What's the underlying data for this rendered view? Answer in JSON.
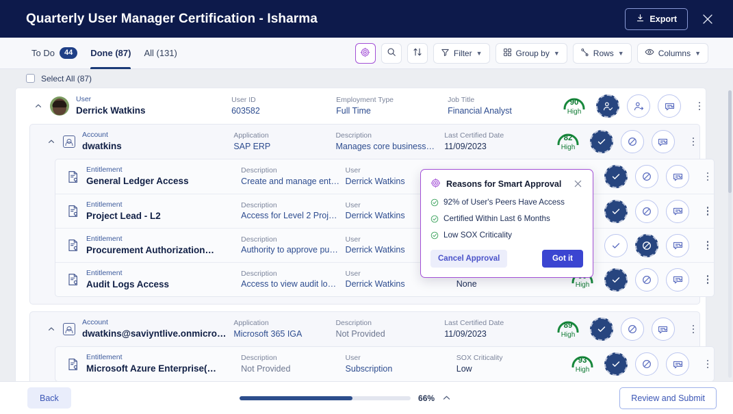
{
  "header": {
    "title": "Quarterly User Manager Certification - Isharma",
    "export_label": "Export",
    "export_icon": "download-icon",
    "close_icon": "close-icon"
  },
  "toolbar": {
    "tabs": [
      {
        "label": "To Do",
        "badge": "44",
        "active": false
      },
      {
        "label": "Done (87)",
        "badge": "",
        "active": true
      },
      {
        "label": "All (131)",
        "badge": "",
        "active": false
      }
    ],
    "buttons": [
      {
        "name": "smart-insights-button",
        "label": "",
        "icon": "smart-gem-icon"
      },
      {
        "name": "search-button",
        "label": "",
        "icon": "search-icon"
      },
      {
        "name": "sort-button",
        "label": "",
        "icon": "sort-arrows-icon"
      },
      {
        "name": "filter-button",
        "label": "Filter",
        "icon": "funnel-icon"
      },
      {
        "name": "group-by-button",
        "label": "Group by",
        "icon": "grid-icon"
      },
      {
        "name": "rows-button",
        "label": "Rows",
        "icon": "rows-icon"
      },
      {
        "name": "columns-button",
        "label": "Columns",
        "icon": "eye-icon"
      }
    ]
  },
  "select_all": {
    "label": "Select All (87)",
    "checked": false
  },
  "user": {
    "caret": "chevron-up-icon",
    "fields": [
      {
        "label": "User",
        "value": "Derrick Watkins",
        "style": "bold"
      },
      {
        "label": "User ID",
        "value": "603582",
        "style": "link"
      },
      {
        "label": "Employment Type",
        "value": "Full Time",
        "style": "link"
      },
      {
        "label": "Job Title",
        "value": "Financial Analyst",
        "style": "link"
      }
    ],
    "score": {
      "value": "90",
      "level": "High"
    },
    "actions": [
      {
        "name": "approve-user-button",
        "icon": "user-check-icon",
        "selected": true
      },
      {
        "name": "revoke-user-button",
        "icon": "user-remove-icon",
        "selected": false
      },
      {
        "name": "comment-user-button",
        "icon": "comment-reassign-icon",
        "selected": false
      }
    ]
  },
  "accounts": [
    {
      "caret": "chevron-up-icon",
      "icon": "account-icon",
      "fields": [
        {
          "label": "Account",
          "value": "dwatkins",
          "style": "bold"
        },
        {
          "label": "Application",
          "value": "SAP ERP",
          "style": "link"
        },
        {
          "label": "Description",
          "value": "Manages core business…",
          "style": "link"
        },
        {
          "label": "Last Certified Date",
          "value": "11/09/2023",
          "style": "plain"
        }
      ],
      "score": {
        "value": "82",
        "level": "High"
      },
      "actions": [
        {
          "name": "approve-account-button",
          "icon": "check-icon",
          "selected": true
        },
        {
          "name": "revoke-account-button",
          "icon": "deny-icon",
          "selected": false
        },
        {
          "name": "comment-account-button",
          "icon": "comment-reassign-icon",
          "selected": false
        }
      ],
      "entitlements": [
        {
          "icon": "entitlement-icon",
          "fields": [
            {
              "label": "Entitlement",
              "value": "General Ledger Access",
              "style": "bold"
            },
            {
              "label": "Description",
              "value": "Create and manage ent…",
              "style": "link"
            },
            {
              "label": "User",
              "value": "Derrick Watkins",
              "style": "link"
            },
            {
              "label": "SOX Criticality",
              "value": "",
              "style": "plain"
            }
          ],
          "score": {
            "value": "",
            "level": ""
          },
          "actions": [
            {
              "name": "approve-entitlement-button",
              "icon": "check-icon",
              "selected": true
            },
            {
              "name": "revoke-entitlement-button",
              "icon": "deny-icon",
              "selected": false
            },
            {
              "name": "comment-entitlement-button",
              "icon": "comment-reassign-icon",
              "selected": false
            }
          ]
        },
        {
          "icon": "entitlement-icon",
          "fields": [
            {
              "label": "Entitlement",
              "value": "Project Lead - L2",
              "style": "bold"
            },
            {
              "label": "Description",
              "value": "Access for Level 2 Proj…",
              "style": "link"
            },
            {
              "label": "User",
              "value": "Derrick Watkins",
              "style": "link"
            },
            {
              "label": "SOX Criticality",
              "value": "",
              "style": "plain"
            }
          ],
          "score": {
            "value": "",
            "level": ""
          },
          "actions": [
            {
              "name": "approve-entitlement-button",
              "icon": "check-icon",
              "selected": true
            },
            {
              "name": "revoke-entitlement-button",
              "icon": "deny-icon",
              "selected": false
            },
            {
              "name": "comment-entitlement-button",
              "icon": "comment-reassign-icon",
              "selected": false
            }
          ]
        },
        {
          "icon": "entitlement-icon",
          "fields": [
            {
              "label": "Entitlement",
              "value": "Procurement Authorization…",
              "style": "bold"
            },
            {
              "label": "Description",
              "value": "Authority to approve pu…",
              "style": "link"
            },
            {
              "label": "User",
              "value": "Derrick Watkins",
              "style": "link"
            },
            {
              "label": "SOX Criticality",
              "value": "",
              "style": "plain"
            }
          ],
          "score": {
            "value": "",
            "level": ""
          },
          "actions": [
            {
              "name": "approve-entitlement-button",
              "icon": "check-icon",
              "selected": false
            },
            {
              "name": "revoke-entitlement-button",
              "icon": "deny-icon",
              "selected": true
            },
            {
              "name": "comment-entitlement-button",
              "icon": "comment-reassign-icon",
              "selected": false
            }
          ]
        },
        {
          "icon": "entitlement-icon",
          "fields": [
            {
              "label": "Entitlement",
              "value": "Audit Logs Access",
              "style": "bold"
            },
            {
              "label": "Description",
              "value": "Access to view audit lo…",
              "style": "link"
            },
            {
              "label": "User",
              "value": "Derrick Watkins",
              "style": "link"
            },
            {
              "label": "SOX Criticality",
              "value": "None",
              "style": "plain"
            }
          ],
          "score": {
            "value": "90",
            "level": "High"
          },
          "actions": [
            {
              "name": "approve-entitlement-button",
              "icon": "check-icon",
              "selected": true
            },
            {
              "name": "revoke-entitlement-button",
              "icon": "deny-icon",
              "selected": false
            },
            {
              "name": "comment-entitlement-button",
              "icon": "comment-reassign-icon",
              "selected": false
            }
          ]
        }
      ]
    },
    {
      "caret": "chevron-up-icon",
      "icon": "account-icon",
      "fields": [
        {
          "label": "Account",
          "value": "dwatkins@saviyntlive.onmicro…",
          "style": "bold"
        },
        {
          "label": "Application",
          "value": "Microsoft 365 IGA",
          "style": "link"
        },
        {
          "label": "Description",
          "value": "Not Provided",
          "style": "gray"
        },
        {
          "label": "Last Certified Date",
          "value": "11/09/2023",
          "style": "plain"
        }
      ],
      "score": {
        "value": "89",
        "level": "High"
      },
      "actions": [
        {
          "name": "approve-account-button",
          "icon": "check-icon",
          "selected": true
        },
        {
          "name": "revoke-account-button",
          "icon": "deny-icon",
          "selected": false
        },
        {
          "name": "comment-account-button",
          "icon": "comment-reassign-icon",
          "selected": false
        }
      ],
      "entitlements": [
        {
          "icon": "entitlement-icon",
          "fields": [
            {
              "label": "Entitlement",
              "value": "Microsoft Azure Enterprise(…",
              "style": "bold"
            },
            {
              "label": "Description",
              "value": "Not Provided",
              "style": "gray"
            },
            {
              "label": "User",
              "value": "Subscription",
              "style": "link"
            },
            {
              "label": "SOX Criticality",
              "value": "Low",
              "style": "plain"
            }
          ],
          "score": {
            "value": "93",
            "level": "High"
          },
          "actions": [
            {
              "name": "approve-entitlement-button",
              "icon": "check-icon",
              "selected": true
            },
            {
              "name": "revoke-entitlement-button",
              "icon": "deny-icon",
              "selected": false
            },
            {
              "name": "comment-entitlement-button",
              "icon": "comment-reassign-icon",
              "selected": false
            }
          ]
        }
      ]
    }
  ],
  "popup": {
    "icon": "smart-gem-icon",
    "title": "Reasons for Smart Approval",
    "close_icon": "close-icon",
    "reasons": [
      "92% of User's Peers Have Access",
      "Certified Within Last 6 Months",
      "Low SOX Criticality"
    ],
    "cancel_label": "Cancel Approval",
    "confirm_label": "Got it"
  },
  "footer": {
    "back_label": "Back",
    "progress_pct": "66%",
    "progress_value": 66,
    "collapse_icon": "chevron-up-icon",
    "submit_label": "Review and Submit"
  },
  "colors": {
    "header_bg": "#0d1a4b",
    "accent_blue": "#27457f",
    "smart_purple": "#a24fd6",
    "score_green": "#0f7a33",
    "primary_button": "#3b45d1"
  }
}
